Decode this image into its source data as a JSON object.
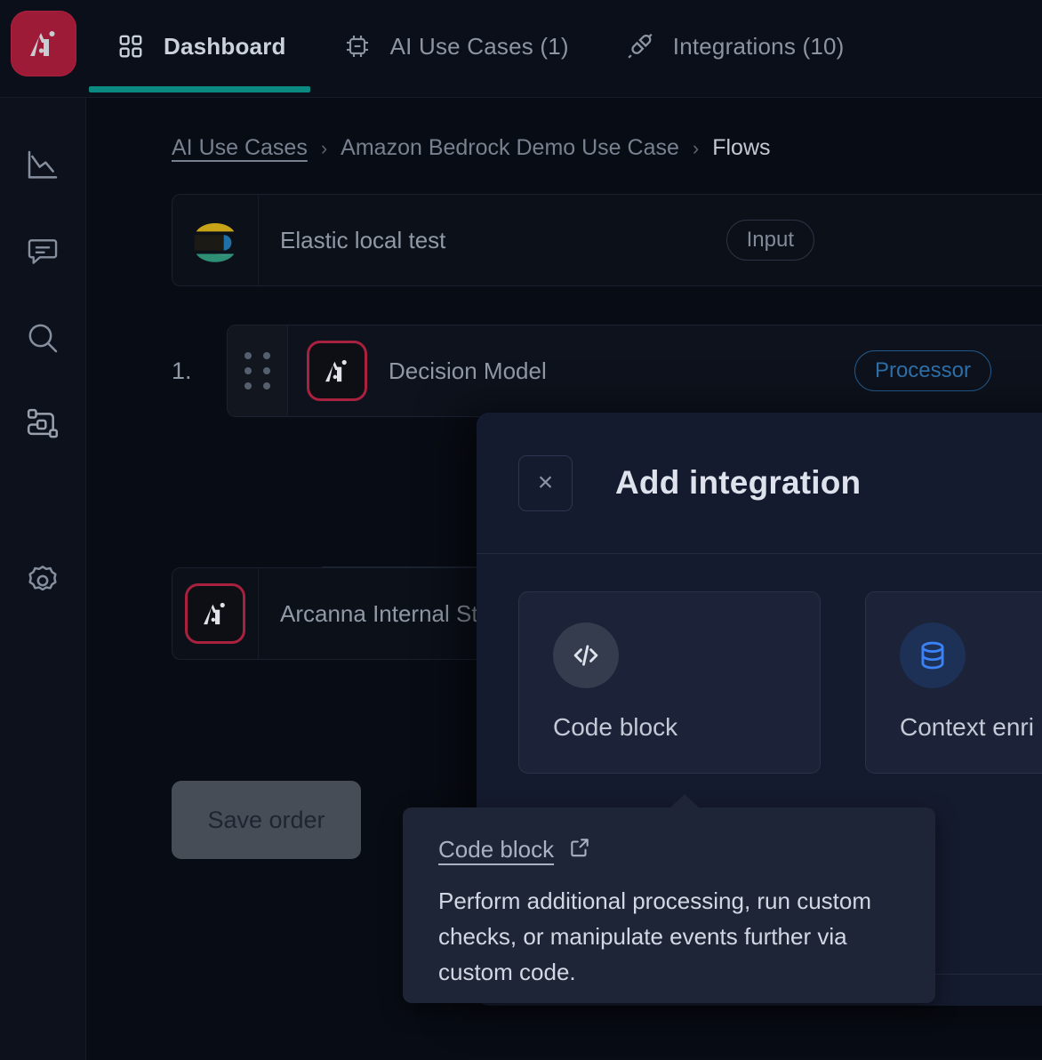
{
  "app": {
    "logo_icon": "arcanna-ai-logo",
    "brand_color": "#9e1b38",
    "accent_color": "#0a8a80"
  },
  "topnav": {
    "tabs": [
      {
        "label": "Dashboard",
        "icon": "grid-icon",
        "active": true
      },
      {
        "label": "AI Use Cases (1)",
        "icon": "chip-icon",
        "active": false
      },
      {
        "label": "Integrations (10)",
        "icon": "plug-icon",
        "active": false
      }
    ]
  },
  "sidebar": {
    "items": [
      {
        "icon": "analytics-chart-icon",
        "name": "analytics"
      },
      {
        "icon": "feedback-chat-icon",
        "name": "feedback"
      },
      {
        "icon": "search-icon",
        "name": "search"
      },
      {
        "icon": "flows-nodes-icon",
        "name": "flows"
      },
      {
        "icon": "gear-icon",
        "name": "settings"
      }
    ]
  },
  "breadcrumb": {
    "link": "AI Use Cases",
    "separator": "›",
    "middle": "Amazon Bedrock Demo Use Case",
    "current": "Flows"
  },
  "flow": {
    "input_row": {
      "icon": "elastic-logo",
      "name": "Elastic local test",
      "badge": "Input"
    },
    "steps": [
      {
        "number": "1.",
        "drag_handle": "drag-handle-icon",
        "icon": "arcanna-ai-logo",
        "name": "Decision Model",
        "badge": "Processor"
      }
    ],
    "add_integration": {
      "label": "Add integration",
      "icon": "plus-icon"
    },
    "output_row": {
      "icon": "arcanna-ai-logo",
      "name": "Arcanna Internal St"
    },
    "save_button": {
      "label": "Save order",
      "disabled": true
    }
  },
  "modal": {
    "title": "Add integration",
    "close_icon": "close-icon",
    "close_label": "×",
    "cards": [
      {
        "label": "Code block",
        "icon": "code-brackets-icon",
        "icon_color": "#cfd6e2",
        "badge_bg": "#343c4e"
      },
      {
        "label": "Context enri",
        "icon": "database-icon",
        "icon_color": "#3b82f6",
        "badge_bg": "#1d3055"
      }
    ]
  },
  "tooltip": {
    "title": "Code block",
    "external_icon": "external-link-icon",
    "description": "Perform additional processing, run custom checks, or manipulate events further via custom code."
  }
}
